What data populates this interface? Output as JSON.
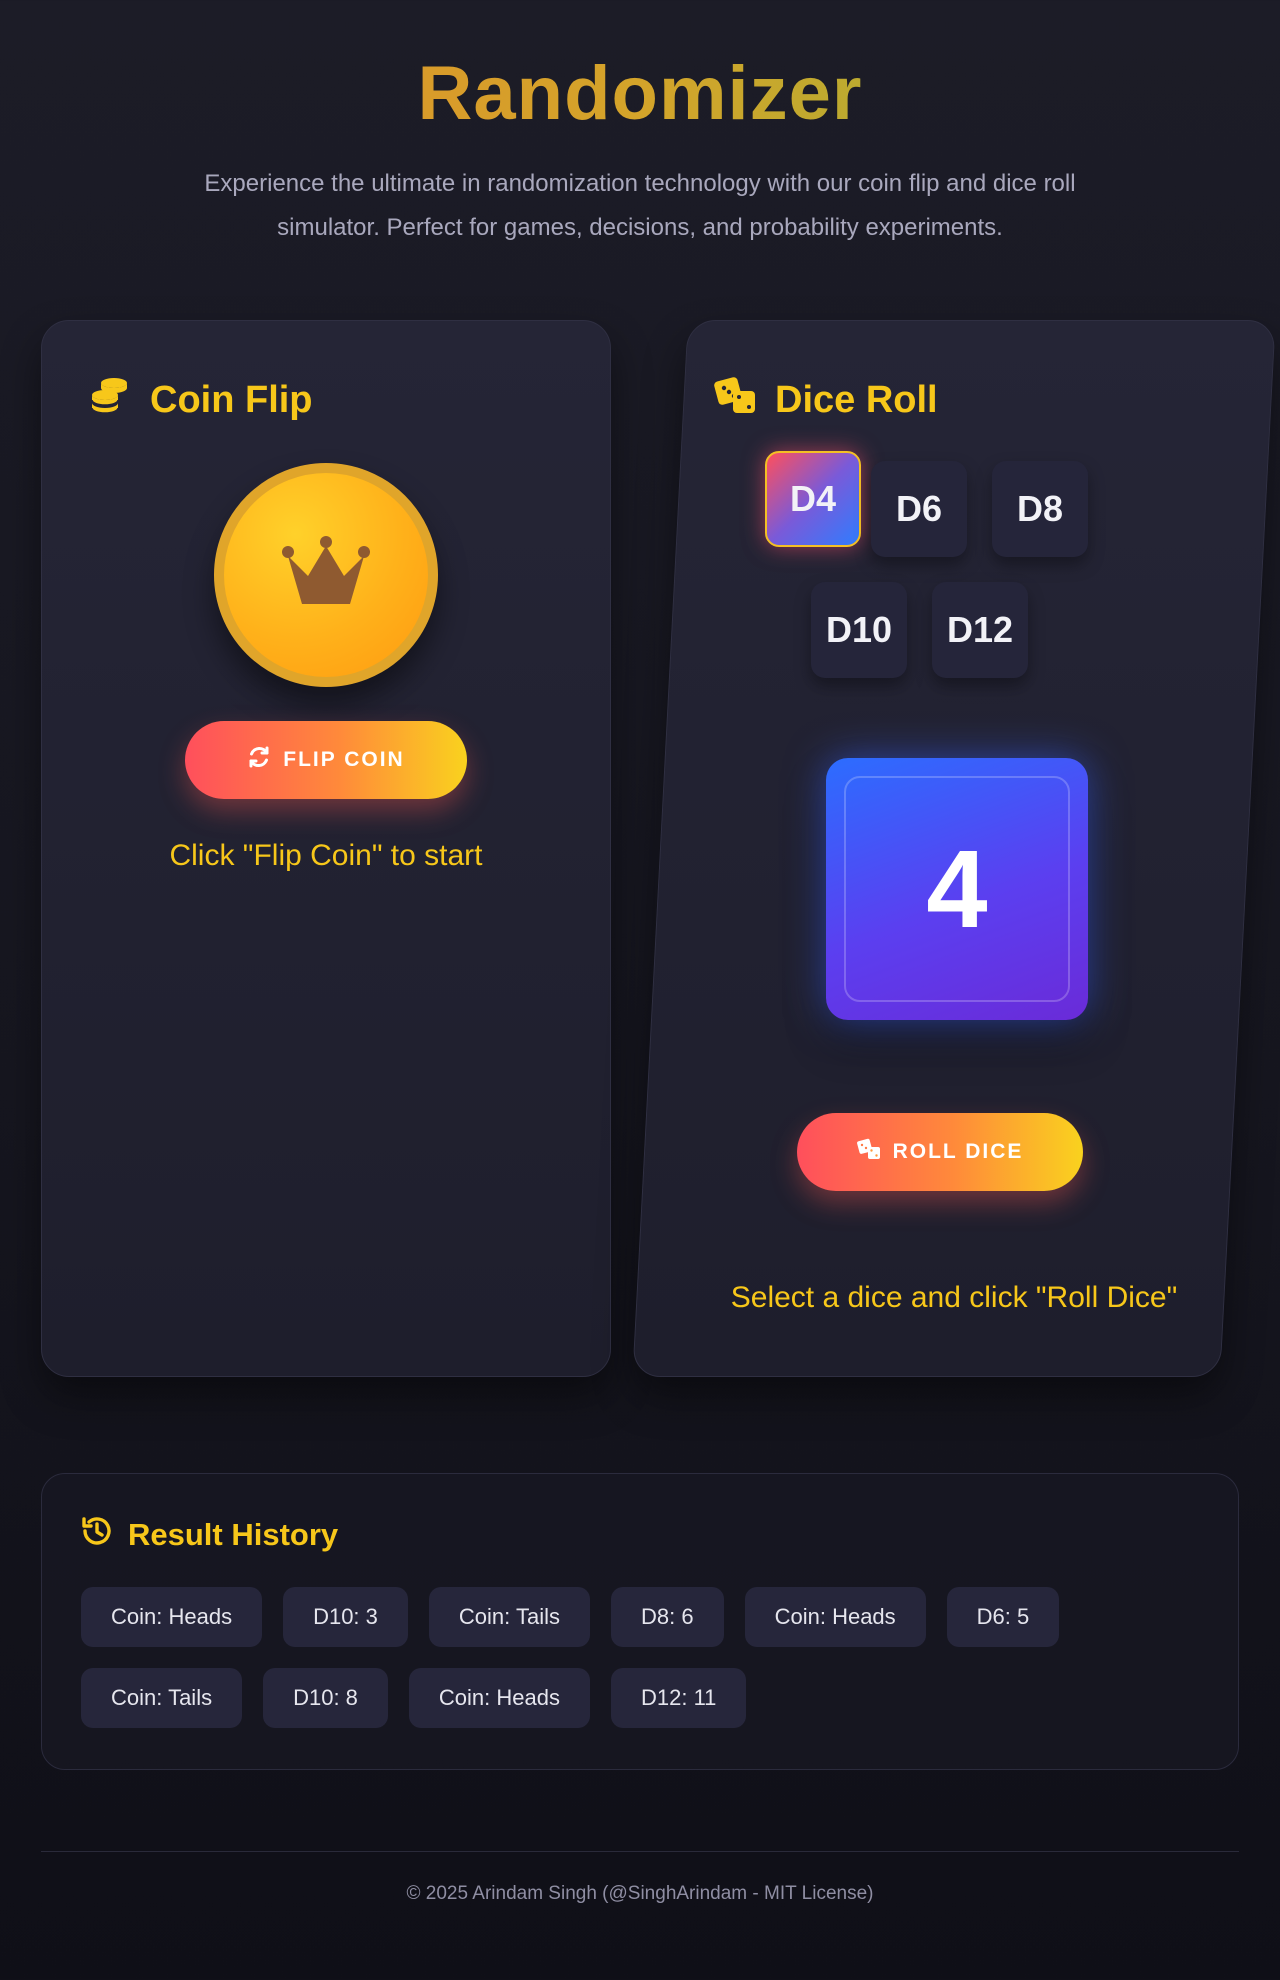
{
  "header": {
    "title": "Randomizer",
    "subtitle": "Experience the ultimate in randomization technology with our coin flip and dice roll simulator. Perfect for games, decisions, and probability experiments."
  },
  "coin": {
    "heading": "Coin Flip",
    "button_label": "FLIP COIN",
    "status": "Click \"Flip Coin\" to start"
  },
  "dice": {
    "heading": "Dice Roll",
    "options": [
      "D4",
      "D6",
      "D8",
      "D10",
      "D12"
    ],
    "selected": "D4",
    "result": "4",
    "button_label": "ROLL DICE",
    "status": "Select a dice and click \"Roll Dice\""
  },
  "history": {
    "heading": "Result History",
    "items": [
      "Coin: Heads",
      "D10: 3",
      "Coin: Tails",
      "D8: 6",
      "Coin: Heads",
      "D6: 5",
      "Coin: Tails",
      "D10: 8",
      "Coin: Heads",
      "D12: 11"
    ]
  },
  "footer": {
    "text": "© 2025 Arindam Singh (@SinghArindam - MIT License)"
  },
  "colors": {
    "accent": "#f7c71a",
    "button_start": "#ff4f5c",
    "button_end": "#f9d21e",
    "die_face": "#4a50f0"
  }
}
